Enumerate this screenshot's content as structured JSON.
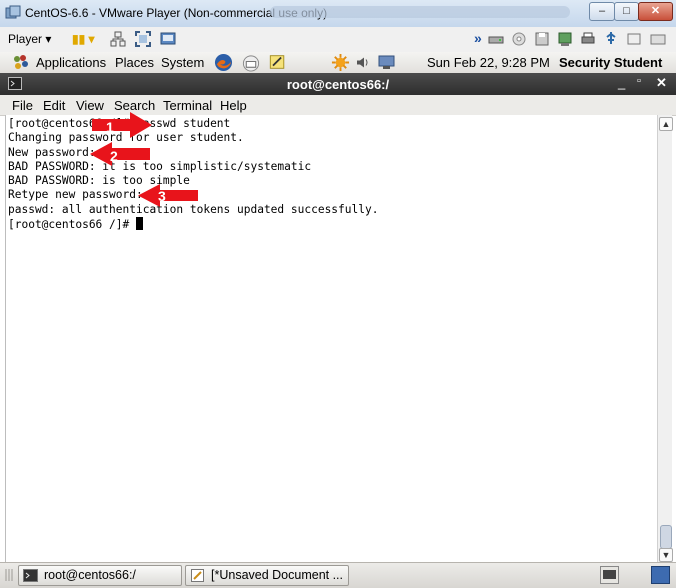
{
  "window": {
    "title": "CentOS-6.6 - VMware Player (Non-commercial use only)",
    "minimize": "–",
    "maximize": "□",
    "close": "✕"
  },
  "toolbar": {
    "player_label": "Player ▾",
    "pause_label": "▮▮ ▾",
    "more": "»"
  },
  "panel": {
    "applications": "Applications",
    "places": "Places",
    "system": "System",
    "datetime": "Sun Feb 22,  9:28 PM",
    "user": "Security Student"
  },
  "terminal": {
    "title": "root@centos66:/",
    "menu": [
      "File",
      "Edit",
      "View",
      "Search",
      "Terminal",
      "Help"
    ],
    "lines": [
      "[root@centos66 /]# passwd student",
      "Changing password for user student.",
      "New password:",
      "BAD PASSWORD: it is too simplistic/systematic",
      "BAD PASSWORD: is too simple",
      "Retype new password:",
      "passwd: all authentication tokens updated successfully.",
      "[root@centos66 /]# "
    ]
  },
  "annotations": [
    {
      "number": "1"
    },
    {
      "number": "2"
    },
    {
      "number": "3"
    }
  ],
  "taskbar": {
    "items": [
      {
        "label": "root@centos66:/"
      },
      {
        "label": "[*Unsaved Document ..."
      }
    ]
  },
  "colors": {
    "annotation_red": "#e8141b",
    "terminal_bg": "#ffffff",
    "terminal_title_bg": "#3a3a3a"
  }
}
